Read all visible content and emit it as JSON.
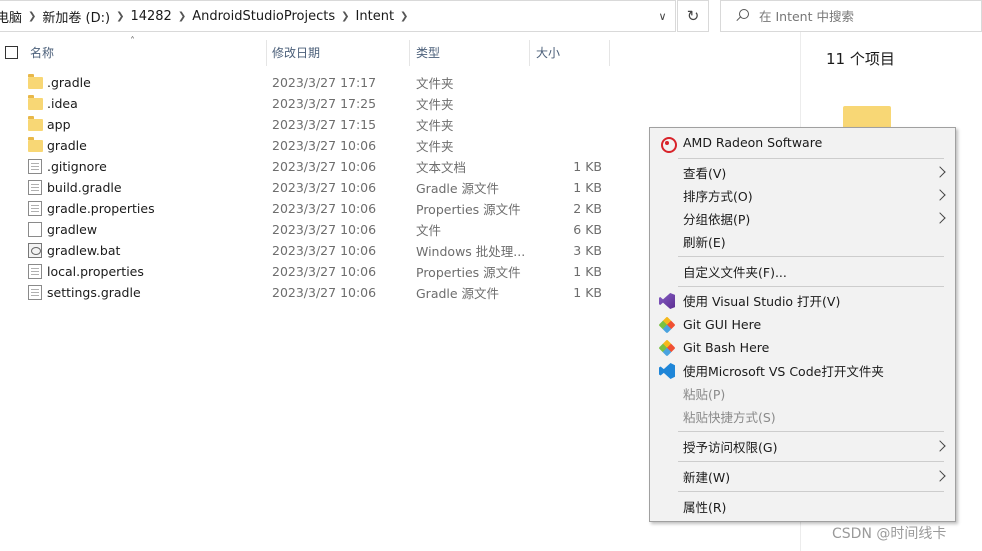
{
  "breadcrumb": [
    "电脑",
    "新加卷 (D:)",
    "14282",
    "AndroidStudioProjects",
    "Intent"
  ],
  "search": {
    "placeholder": "在 Intent 中搜索"
  },
  "columns": {
    "name": "名称",
    "date": "修改日期",
    "type": "类型",
    "size": "大小"
  },
  "files": [
    {
      "name": ".gradle",
      "date": "2023/3/27 17:17",
      "type": "文件夹",
      "size": "",
      "icon": "folder"
    },
    {
      "name": ".idea",
      "date": "2023/3/27 17:25",
      "type": "文件夹",
      "size": "",
      "icon": "folder"
    },
    {
      "name": "app",
      "date": "2023/3/27 17:15",
      "type": "文件夹",
      "size": "",
      "icon": "folder"
    },
    {
      "name": "gradle",
      "date": "2023/3/27 10:06",
      "type": "文件夹",
      "size": "",
      "icon": "folder"
    },
    {
      "name": ".gitignore",
      "date": "2023/3/27 10:06",
      "type": "文本文档",
      "size": "1 KB",
      "icon": "doc"
    },
    {
      "name": "build.gradle",
      "date": "2023/3/27 10:06",
      "type": "Gradle 源文件",
      "size": "1 KB",
      "icon": "doc"
    },
    {
      "name": "gradle.properties",
      "date": "2023/3/27 10:06",
      "type": "Properties 源文件",
      "size": "2 KB",
      "icon": "doc"
    },
    {
      "name": "gradlew",
      "date": "2023/3/27 10:06",
      "type": "文件",
      "size": "6 KB",
      "icon": "blank"
    },
    {
      "name": "gradlew.bat",
      "date": "2023/3/27 10:06",
      "type": "Windows 批处理...",
      "size": "3 KB",
      "icon": "bat"
    },
    {
      "name": "local.properties",
      "date": "2023/3/27 10:06",
      "type": "Properties 源文件",
      "size": "1 KB",
      "icon": "doc"
    },
    {
      "name": "settings.gradle",
      "date": "2023/3/27 10:06",
      "type": "Gradle 源文件",
      "size": "1 KB",
      "icon": "doc"
    }
  ],
  "details": {
    "item_count": "11 个项目"
  },
  "context_menu": {
    "amd": "AMD Radeon Software",
    "view": "查看(V)",
    "sort": "排序方式(O)",
    "group": "分组依据(P)",
    "refresh": "刷新(E)",
    "customize": "自定义文件夹(F)...",
    "open_vs": "使用 Visual Studio 打开(V)",
    "git_gui": "Git GUI Here",
    "git_bash": "Git Bash Here",
    "open_vscode": "使用Microsoft VS Code打开文件夹",
    "paste": "粘贴(P)",
    "paste_shortcut": "粘贴快捷方式(S)",
    "grant_access": "授予访问权限(G)",
    "new": "新建(W)",
    "properties": "属性(R)"
  },
  "watermark": "CSDN @时间线卡"
}
